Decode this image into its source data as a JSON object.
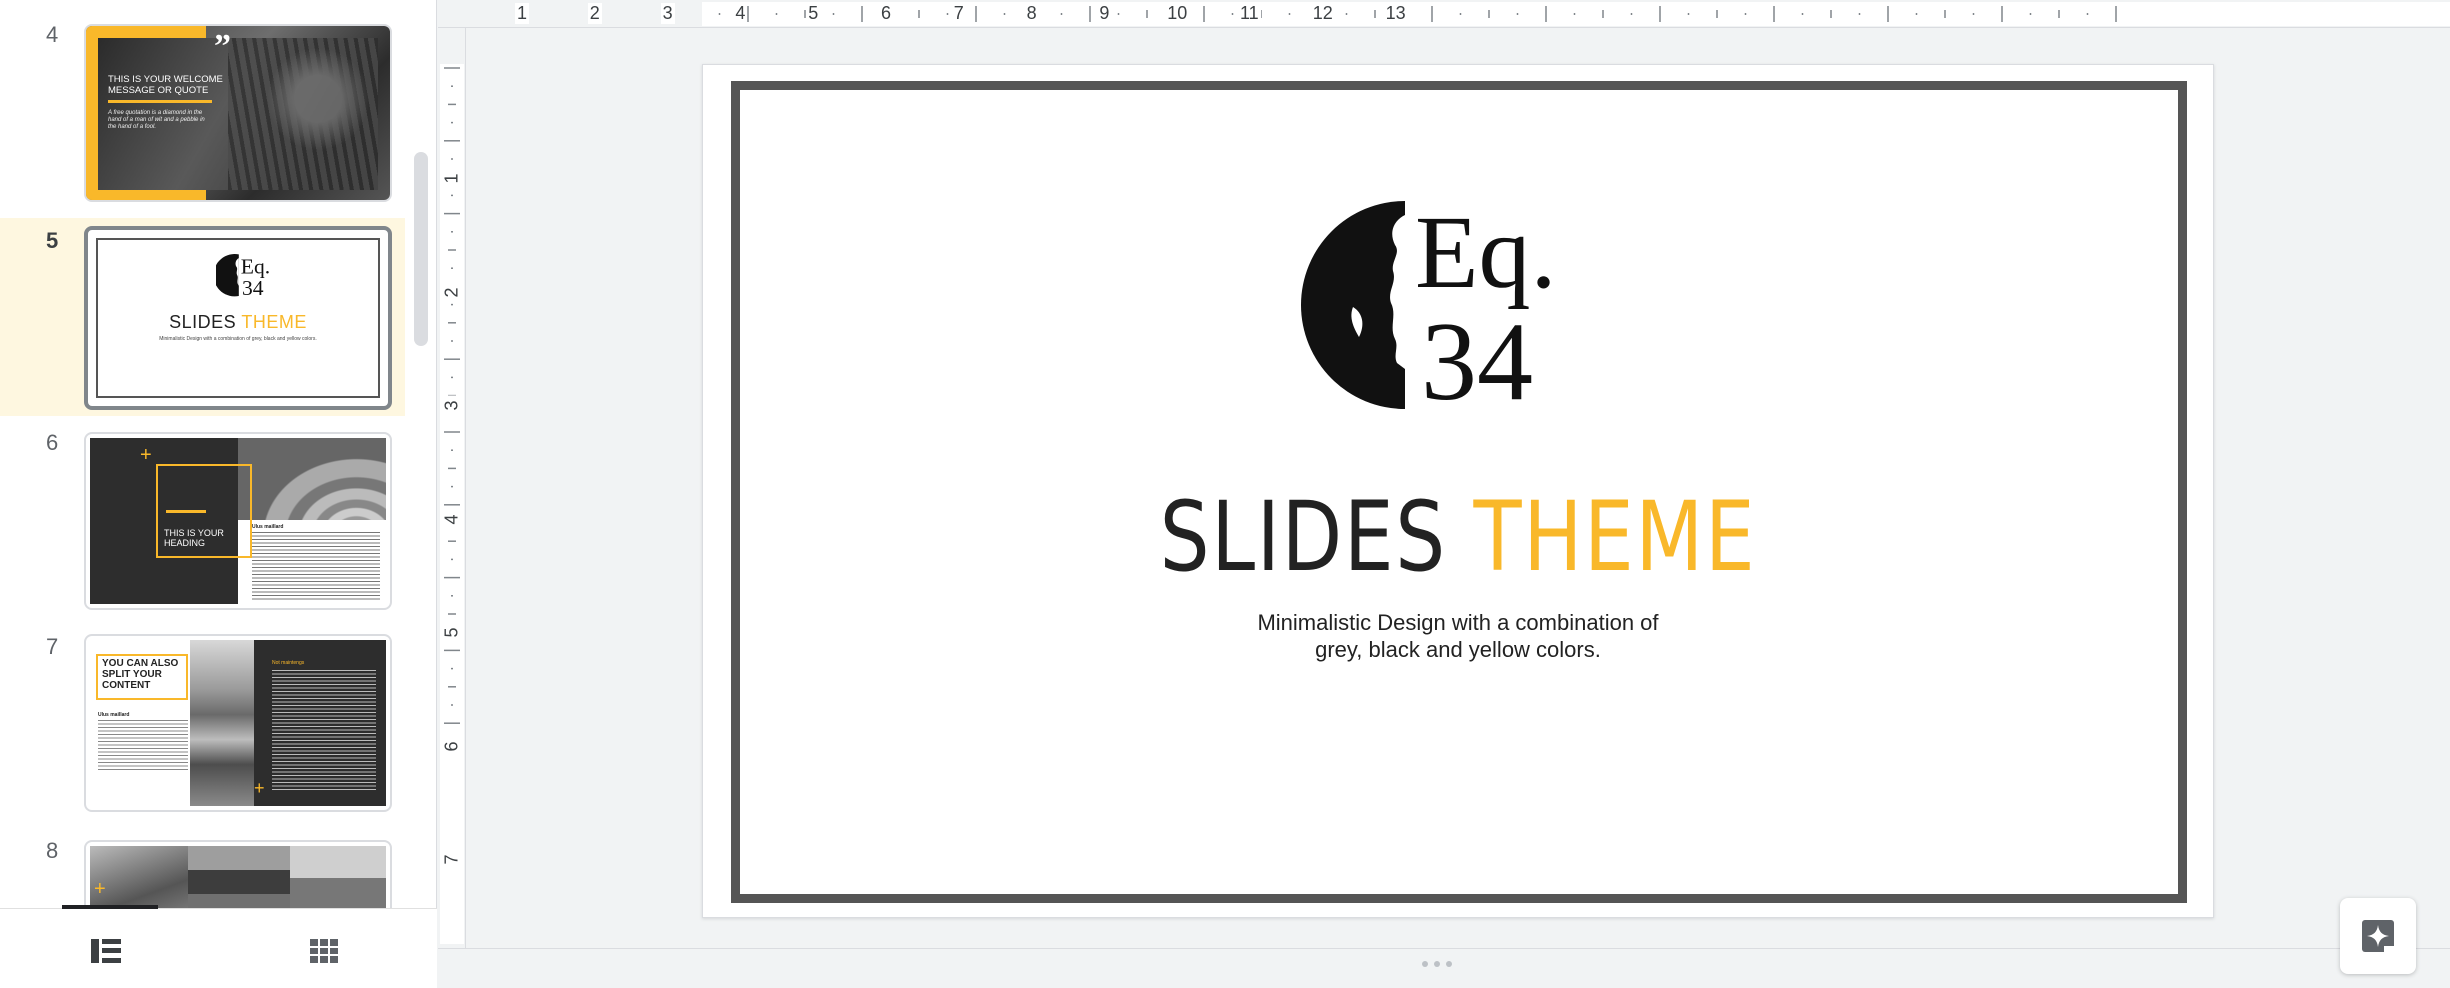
{
  "filmstrip": {
    "slides": [
      {
        "number": "4",
        "quote_mark": "”",
        "title": "THIS IS YOUR WELCOME MESSAGE OR QUOTE",
        "body": "A free quotation is a diamond in the hand of a man of wit and a pebble in the hand of a fool."
      },
      {
        "number": "5",
        "logo_text_top": "Eq.",
        "logo_text_bottom": "34",
        "title_main": "SLIDES",
        "title_accent": "THEME",
        "subtitle": "Minimalistic Design with a combination of grey, black and yellow colors."
      },
      {
        "number": "6",
        "heading": "THIS IS YOUR HEADING",
        "sub": "Ulus maillard"
      },
      {
        "number": "7",
        "title": "YOU CAN ALSO SPLIT YOUR CONTENT",
        "name": "Ulus maillard",
        "dark_name": "Not maintengs"
      },
      {
        "number": "8"
      }
    ],
    "view_buttons": {
      "filmstrip_icon": "filmstrip-view-icon",
      "grid_icon": "grid-view-icon"
    }
  },
  "rulers": {
    "horizontal": [
      "1",
      "2",
      "3",
      "4",
      "5",
      "6",
      "7",
      "8",
      "9",
      "10",
      "11",
      "12",
      "13"
    ],
    "vertical": [
      "1",
      "2",
      "3",
      "4",
      "5",
      "6",
      "7"
    ]
  },
  "slide": {
    "logo_text_top": "Eq.",
    "logo_text_bottom": "34",
    "title_main": "SLIDES",
    "title_accent": "THEME",
    "subtitle_line1": "Minimalistic Design with a combination of",
    "subtitle_line2": "grey, black and yellow colors."
  },
  "colors": {
    "accent": "#f9b82a",
    "frame": "#555555",
    "selection_bg": "#fef7e0"
  },
  "explore_icon": "explore-sparkle-icon"
}
